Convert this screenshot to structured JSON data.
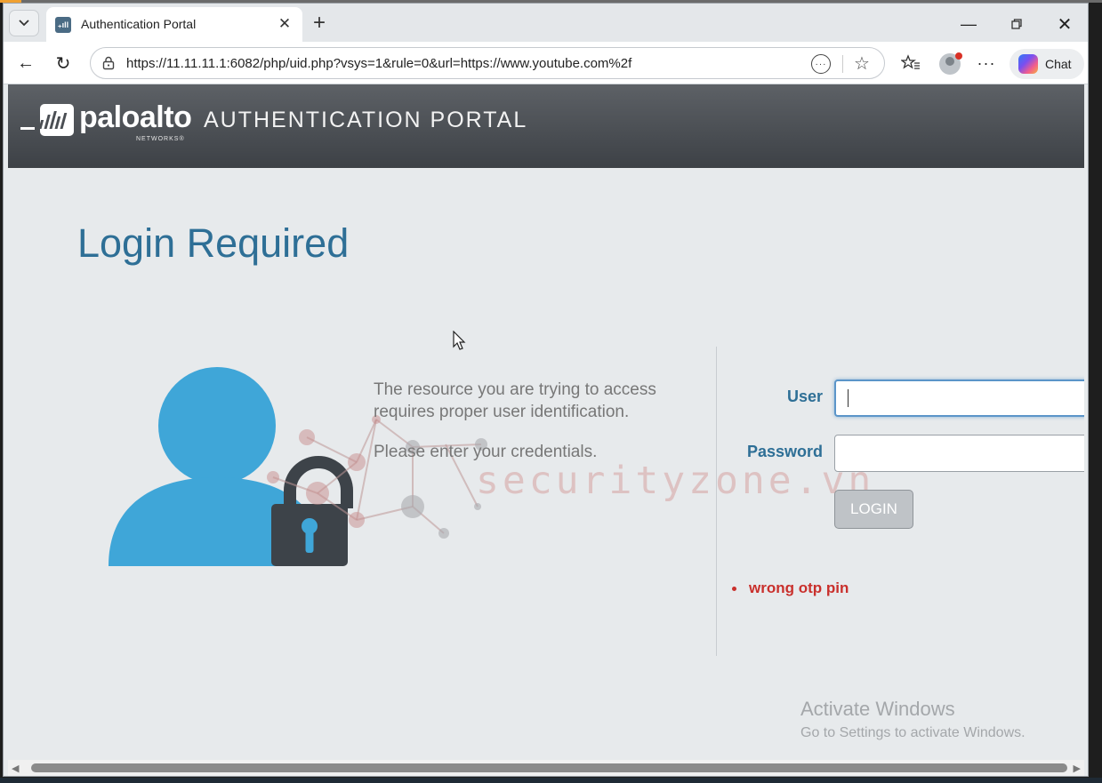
{
  "browser": {
    "tab_title": "Authentication Portal",
    "url": "https://11.11.11.1:6082/php/uid.php?vsys=1&rule=0&url=https://www.youtube.com%2f",
    "chat_label": "Chat",
    "favicon_text": "₊ıll"
  },
  "banner": {
    "logo_word": "paloalto",
    "logo_sub": "NETWORKS®",
    "portal_title": "AUTHENTICATION PORTAL"
  },
  "main": {
    "heading": "Login Required",
    "message_line": "The resource you are trying to access requires proper user identification.",
    "message_prompt": "Please enter your credentials."
  },
  "form": {
    "user_label": "User",
    "user_value": "",
    "password_label": "Password",
    "password_value": "",
    "login_label": "LOGIN"
  },
  "errors": [
    "wrong otp pin"
  ],
  "watermark": "securityzone.vn",
  "windows_notice": {
    "title": "Activate Windows",
    "subtitle": "Go to Settings to activate Windows."
  },
  "colors": {
    "accent": "#2e6f96",
    "error": "#c9302c",
    "figure": "#3fa6d8",
    "lock": "#3d4349"
  },
  "icons": [
    "tab-menu-icon",
    "close-icon",
    "plus-icon",
    "minimize-icon",
    "restore-icon",
    "back-icon",
    "reload-icon",
    "lock-icon",
    "reader-icon",
    "star-icon",
    "favorites-icon",
    "profile-icon",
    "more-icon",
    "copilot-icon",
    "user-icon",
    "padlock-icon",
    "cursor-icon"
  ]
}
